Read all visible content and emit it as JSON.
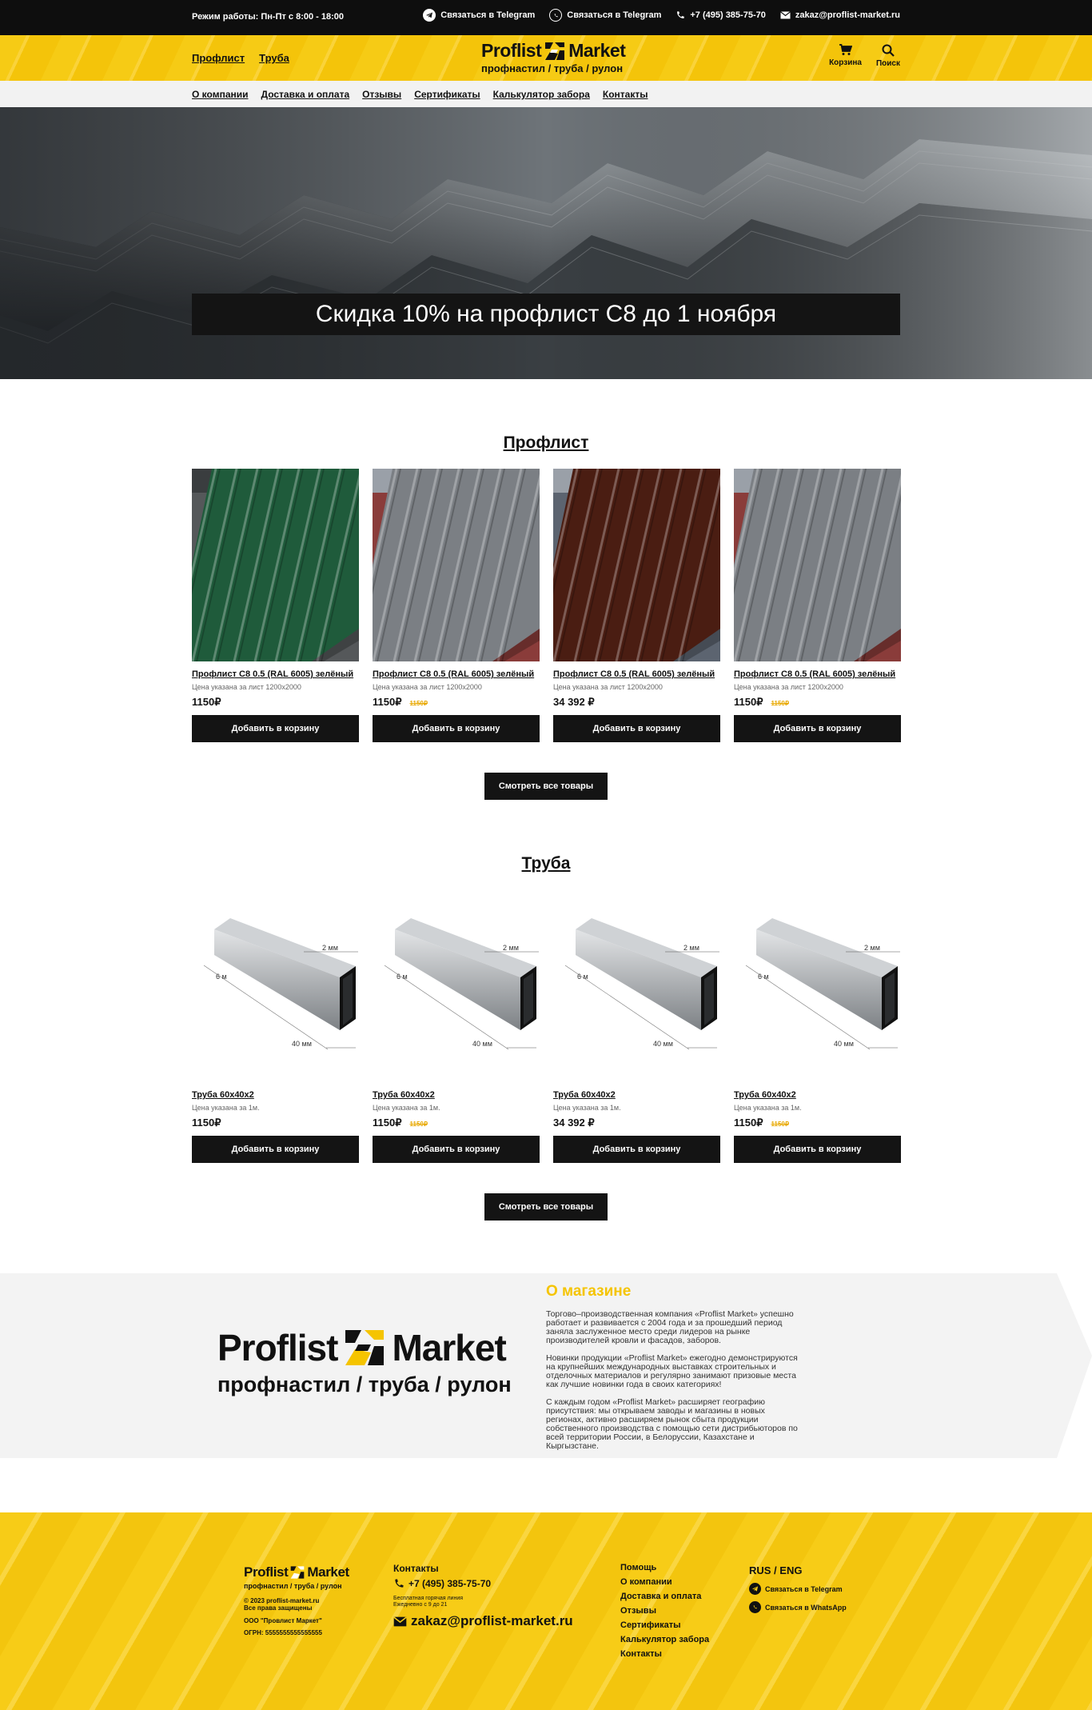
{
  "topbar": {
    "hours": "Режим работы: Пн-Пт с 8:00 - 18:00",
    "telegram": "Связаться в Telegram",
    "whatsapp": "Связаться в Telegram",
    "phone": "+7 (495) 385-75-70",
    "email": "zakaz@proflist-market.ru"
  },
  "header": {
    "nav": [
      "Профлист",
      "Труба"
    ],
    "logo_left": "Proflist",
    "logo_right": "Market",
    "logo_sub": "профнастил / труба / рулон",
    "cart": "Корзина",
    "search": "Поиск"
  },
  "subnav": [
    "О компании",
    "Доставка и оплата",
    "Отзывы",
    "Сертификаты",
    "Калькулятор забора",
    "Контакты"
  ],
  "hero": {
    "banner": "Скидка 10% на профлист С8 до 1 ноября"
  },
  "proflist": {
    "title": "Профлист",
    "products": [
      {
        "name": "Профлист С8 0.5 (RAL 6005) зелёный",
        "note": "Цена указана за лист 1200х2000",
        "price": "1150₽",
        "old": "",
        "color": "#1f5b3b",
        "btn": "Добавить в корзину"
      },
      {
        "name": "Профлист С8 0.5 (RAL 6005) зелёный",
        "note": "Цена указана за лист 1200х2000",
        "price": "1150₽",
        "old": "1150₽",
        "color": "#7b7f84",
        "btn": "Добавить в корзину"
      },
      {
        "name": "Профлист С8 0.5 (RAL 6005) зелёный",
        "note": "Цена указана за лист 1200х2000",
        "price": "34 392 ₽",
        "old": "",
        "color": "#4a1d12",
        "btn": "Добавить в корзину"
      },
      {
        "name": "Профлист С8 0.5 (RAL 6005) зелёный",
        "note": "Цена указана за лист 1200х2000",
        "price": "1150₽",
        "old": "1150₽",
        "color": "#7b7f84",
        "btn": "Добавить в корзину"
      }
    ],
    "view_all": "Смотреть все товары"
  },
  "pipe": {
    "title": "Труба",
    "dim_top": "2 мм",
    "dim_len": "6 м",
    "dim_w": "40 мм",
    "products": [
      {
        "name": "Труба 60х40х2",
        "note": "Цена указана за 1м.",
        "price": "1150₽",
        "old": "",
        "btn": "Добавить в корзину"
      },
      {
        "name": "Труба 60х40х2",
        "note": "Цена указана за 1м.",
        "price": "1150₽",
        "old": "1150₽",
        "btn": "Добавить в корзину"
      },
      {
        "name": "Труба 60х40х2",
        "note": "Цена указана за 1м.",
        "price": "34 392 ₽",
        "old": "",
        "btn": "Добавить в корзину"
      },
      {
        "name": "Труба 60х40х2",
        "note": "Цена указана за 1м.",
        "price": "1150₽",
        "old": "1150₽",
        "btn": "Добавить в корзину"
      }
    ],
    "view_all": "Смотреть все товары"
  },
  "about": {
    "title": "О магазине",
    "p1": "Торгово–производственная компания «Proflist Market» успешно работает и развивается с 2004 года и за прошедший период заняла заслуженное место среди лидеров на рынке производителей кровли и фасадов, заборов.",
    "p2": "Новинки продукции «Proflist Market» ежегодно демонстрируются на крупнейших международных выставках строительных и отделочных материалов и регулярно занимают призовые места как лучшие новинки года в своих категориях!",
    "p3": "С каждым годом «Proflist Market» расширяет географию присутствия: мы открываем заводы и магазины в новых регионах, активно расширяем рынок сбыта продукции собственного производства с помощью сети дистрибьюторов по всей территории России, в Белоруссии, Казахстане и Кыргызстане."
  },
  "footer": {
    "copyright": "© 2023 proflist-market.ru",
    "rights": "Все права защищены",
    "company": "ООО \"Провлист Маркет\"",
    "ogrn": "ОГРН: 5555555555555555",
    "contacts_title": "Контакты",
    "phone": "+7 (495) 385-75-70",
    "hotline": "Бесплатная горячая линия",
    "hotline_hours": "Ежедневно с 9 до 21",
    "email": "zakaz@proflist-market.ru",
    "help_links": [
      "Помощь",
      "О компании",
      "Доставка и оплата",
      "Отзывы",
      "Сертификаты",
      "Калькулятор забора",
      "Контакты"
    ],
    "lang": "RUS / ENG",
    "telegram": "Связаться в Telegram",
    "whatsapp": "Связаться в WhatsApp"
  },
  "colors": {
    "accent": "#f7cc17",
    "dark": "#141414",
    "about_title": "#f5c400",
    "old_price": "#e8a800"
  }
}
